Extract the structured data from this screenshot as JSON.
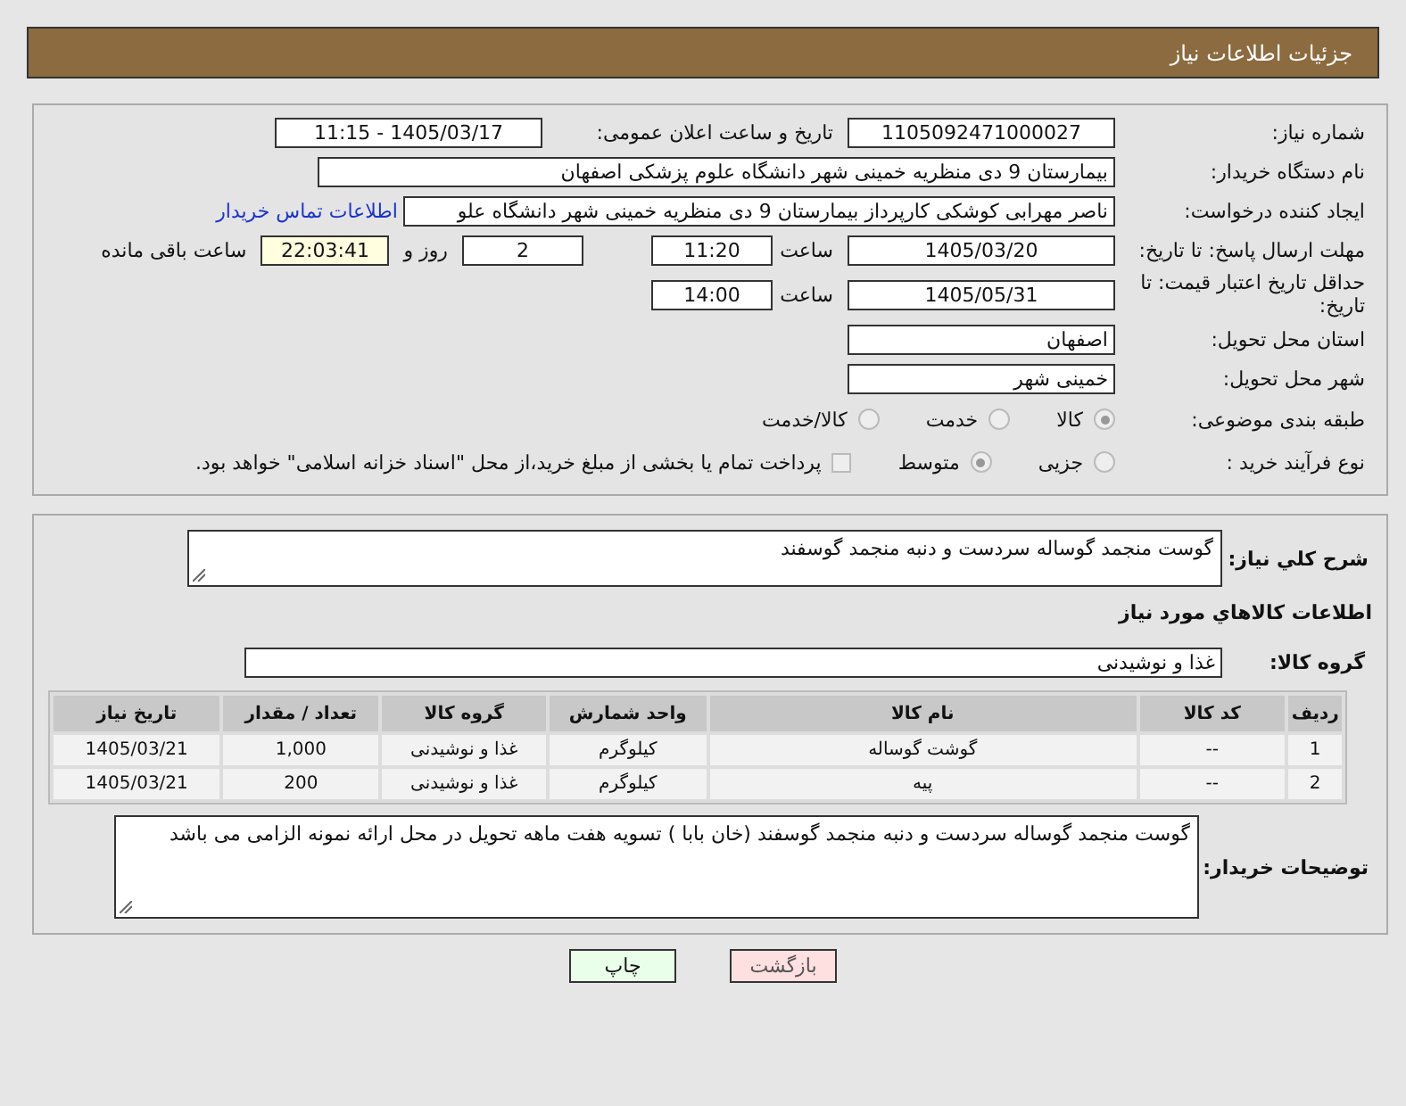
{
  "header": {
    "title": "جزئیات اطلاعات نیاز"
  },
  "need_number": {
    "label": "شماره نیاز:",
    "value": "1105092471000027"
  },
  "announce": {
    "label": "تاریخ و ساعت اعلان عمومی:",
    "value": "1405/03/17 - 11:15"
  },
  "buyer": {
    "label": "نام دستگاه خریدار:",
    "value": "بیمارستان 9 دی منظریه خمینی شهر دانشگاه علوم پزشکی اصفهان"
  },
  "requester": {
    "label": "ایجاد کننده درخواست:",
    "value": "ناصر مهرابی کوشکی کارپرداز بیمارستان 9 دی منظریه خمینی شهر دانشگاه علو",
    "link": "اطلاعات تماس خریدار"
  },
  "reply_deadline": {
    "label": "مهلت ارسال پاسخ: تا تاریخ:",
    "date": "1405/03/20",
    "time_label": "ساعت",
    "time": "11:20",
    "days": "2",
    "days_label": "روز و",
    "remaining": "22:03:41",
    "remaining_label": "ساعت باقی مانده"
  },
  "price_validity": {
    "label": "حداقل تاریخ اعتبار قیمت: تا تاریخ:",
    "date": "1405/05/31",
    "time_label": "ساعت",
    "time": "14:00"
  },
  "province": {
    "label": "استان محل تحویل:",
    "value": "اصفهان"
  },
  "city": {
    "label": "شهر محل تحویل:",
    "value": "خمینی شهر"
  },
  "category": {
    "label": "طبقه بندی موضوعی:",
    "options": [
      {
        "label": "کالا",
        "selected": true
      },
      {
        "label": "خدمت",
        "selected": false
      },
      {
        "label": "کالا/خدمت",
        "selected": false
      }
    ]
  },
  "purchase_type": {
    "label": "نوع فرآیند خرید :",
    "options": [
      {
        "label": "جزیی",
        "selected": false
      },
      {
        "label": "متوسط",
        "selected": true
      }
    ],
    "treasury": {
      "checked": false,
      "text": "پرداخت تمام یا بخشی از مبلغ خرید،از محل \"اسناد خزانه اسلامی\" خواهد بود."
    }
  },
  "description": {
    "label": "شرح کلي نياز:",
    "value": "گوست منجمد گوساله سردست و دنبه منجمد گوسفند"
  },
  "goods_section": {
    "title": "اطلاعات کالاهاي مورد نياز"
  },
  "goods_group": {
    "label": "گروه کالا:",
    "value": "غذا و نوشیدنی"
  },
  "table": {
    "columns": [
      "ردیف",
      "کد کالا",
      "نام کالا",
      "واحد شمارش",
      "گروه کالا",
      "تعداد / مقدار",
      "تاریخ نیاز"
    ],
    "rows": [
      [
        "1",
        "--",
        "گوشت گوساله",
        "کیلوگرم",
        "غذا و نوشیدنی",
        "1,000",
        "1405/03/21"
      ],
      [
        "2",
        "--",
        "پیه",
        "کیلوگرم",
        "غذا و نوشیدنی",
        "200",
        "1405/03/21"
      ]
    ]
  },
  "buyer_notes": {
    "label": "توضیحات خریدار:",
    "value": "گوست منجمد گوساله سردست و دنبه منجمد گوسفند (خان بابا ) تسویه هفت ماهه تحویل در محل ارائه نمونه الزامی می باشد"
  },
  "buttons": [
    {
      "label": "بازگشت",
      "kind": "back"
    },
    {
      "label": "چاپ",
      "kind": "print"
    }
  ]
}
